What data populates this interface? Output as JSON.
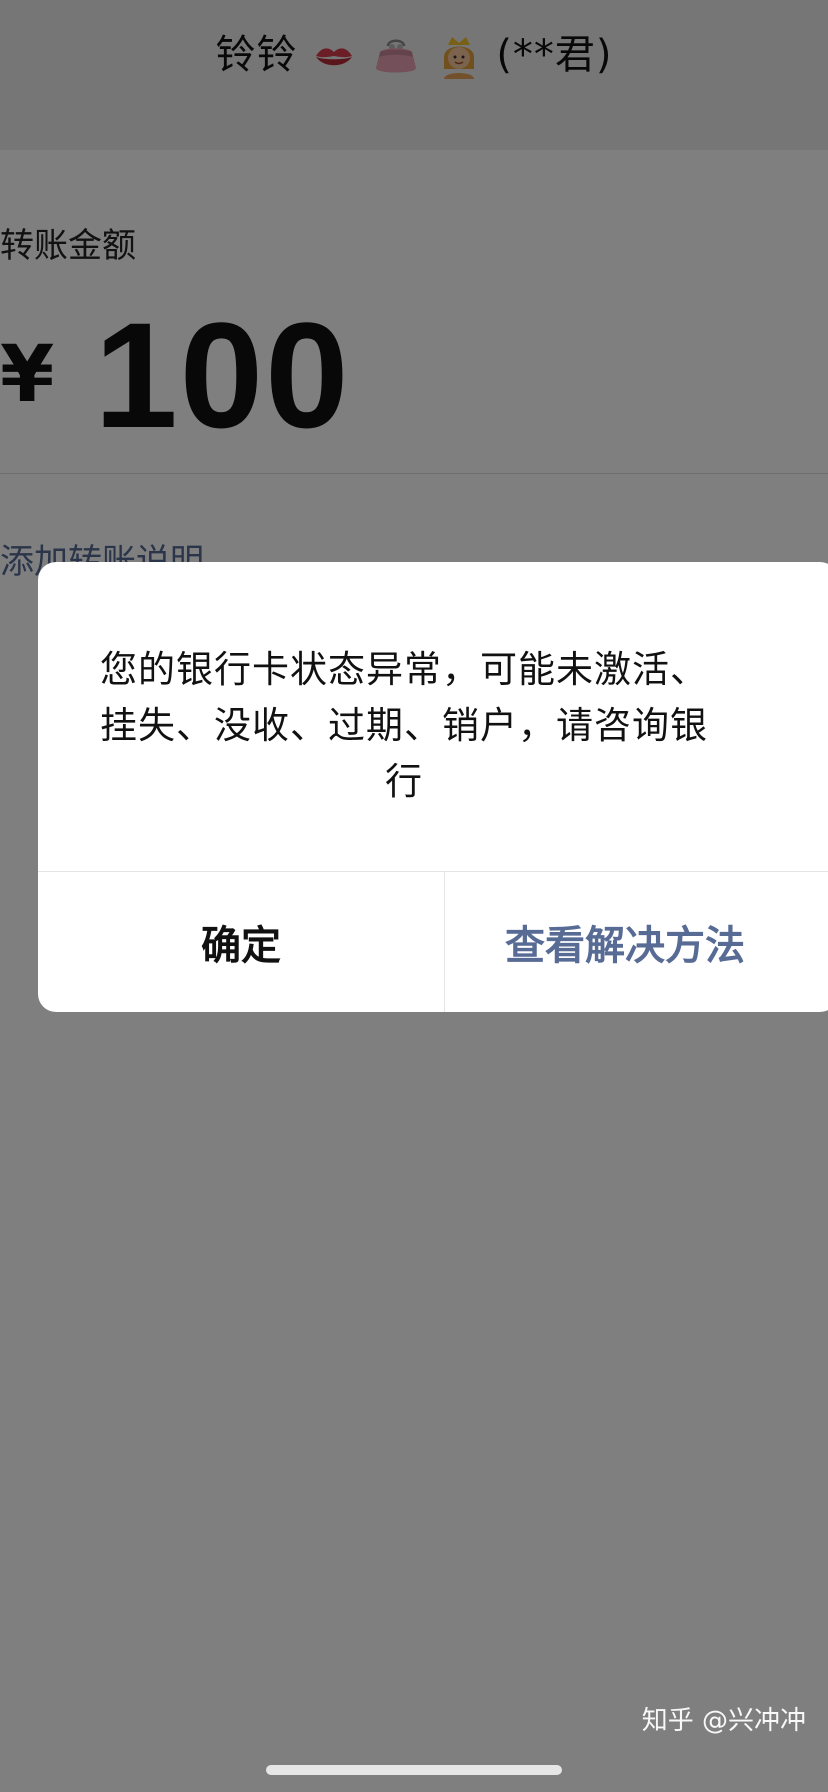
{
  "header": {
    "title_prefix": "铃铃",
    "title_suffix": "(**君)",
    "emojis": [
      "kiss-mark-emoji",
      "purse-emoji",
      "princess-emoji"
    ]
  },
  "transfer": {
    "amount_label": "转账金额",
    "currency_symbol": "¥",
    "amount": "100",
    "add_note_link": "添加转账说明"
  },
  "dialog": {
    "message": "您的银行卡状态异常，可能未激活、挂失、没收、过期、销户，请咨询银行",
    "confirm_label": "确定",
    "solution_label": "查看解决方法"
  },
  "watermark": "知乎 @兴冲冲",
  "colors": {
    "link": "#576b95",
    "mask": "rgba(0,0,0,0.5)",
    "dialog_bg": "#ffffff",
    "header_bg": "#ededed"
  }
}
